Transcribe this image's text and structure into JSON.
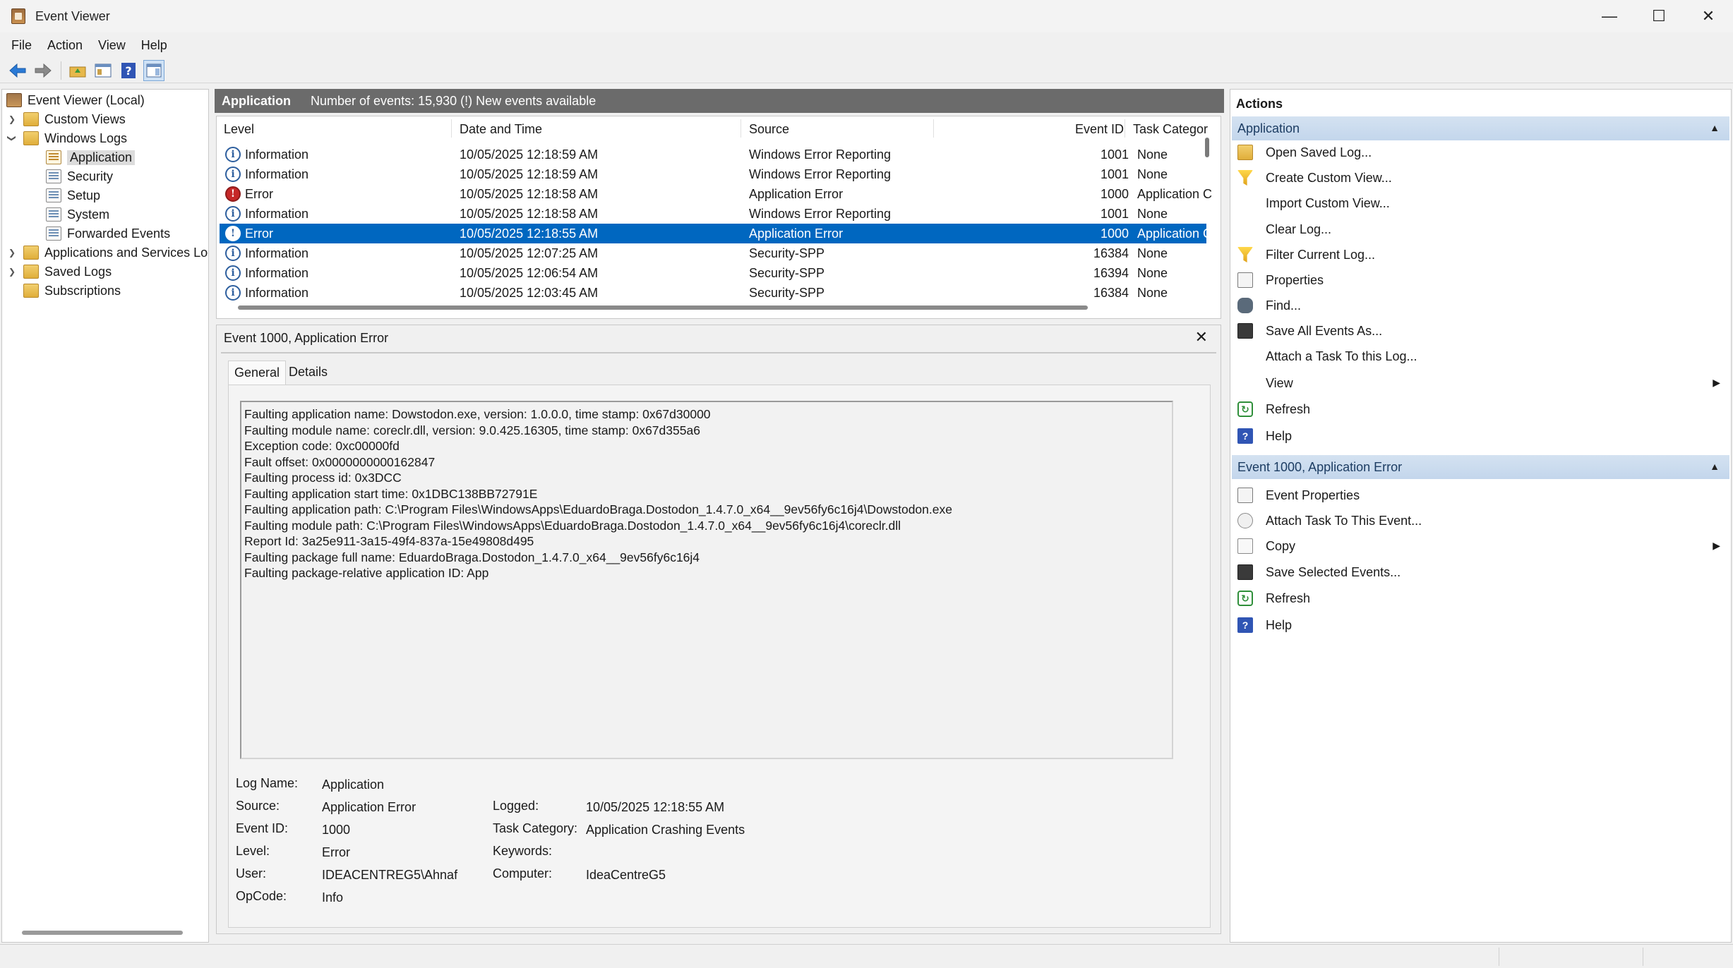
{
  "window": {
    "title": "Event Viewer",
    "minimize": "—",
    "maximize": "☐",
    "close": "✕"
  },
  "menu": [
    "File",
    "Action",
    "View",
    "Help"
  ],
  "tree": {
    "root": "Event Viewer (Local)",
    "custom_views": "Custom Views",
    "windows_logs": "Windows Logs",
    "application": "Application",
    "security": "Security",
    "setup": "Setup",
    "system": "System",
    "forwarded": "Forwarded Events",
    "apps_services": "Applications and Services Logs",
    "saved_logs": "Saved Logs",
    "subscriptions": "Subscriptions"
  },
  "header": {
    "log_name": "Application",
    "count": "Number of events: 15,930 (!) New events available"
  },
  "columns": {
    "level": "Level",
    "date": "Date and Time",
    "source": "Source",
    "event_id": "Event ID",
    "task": "Task Categor"
  },
  "events": [
    {
      "level": "Information",
      "date": "10/05/2025 12:18:59 AM",
      "source": "Windows Error Reporting",
      "id": "1001",
      "task": "None"
    },
    {
      "level": "Information",
      "date": "10/05/2025 12:18:59 AM",
      "source": "Windows Error Reporting",
      "id": "1001",
      "task": "None"
    },
    {
      "level": "Error",
      "date": "10/05/2025 12:18:58 AM",
      "source": "Application Error",
      "id": "1000",
      "task": "Application C"
    },
    {
      "level": "Information",
      "date": "10/05/2025 12:18:58 AM",
      "source": "Windows Error Reporting",
      "id": "1001",
      "task": "None"
    },
    {
      "level": "Error",
      "date": "10/05/2025 12:18:55 AM",
      "source": "Application Error",
      "id": "1000",
      "task": "Application C"
    },
    {
      "level": "Information",
      "date": "10/05/2025 12:07:25 AM",
      "source": "Security-SPP",
      "id": "16384",
      "task": "None"
    },
    {
      "level": "Information",
      "date": "10/05/2025 12:06:54 AM",
      "source": "Security-SPP",
      "id": "16394",
      "task": "None"
    },
    {
      "level": "Information",
      "date": "10/05/2025 12:03:45 AM",
      "source": "Security-SPP",
      "id": "16384",
      "task": "None"
    }
  ],
  "detail": {
    "title": "Event 1000, Application Error",
    "close": "✕",
    "tabs": {
      "general": "General",
      "details": "Details"
    },
    "description": "Faulting application name: Dowstodon.exe, version: 1.0.0.0, time stamp: 0x67d30000\nFaulting module name: coreclr.dll, version: 9.0.425.16305, time stamp: 0x67d355a6\nException code: 0xc00000fd\nFault offset: 0x0000000000162847\nFaulting process id: 0x3DCC\nFaulting application start time: 0x1DBC138BB72791E\nFaulting application path: C:\\Program Files\\WindowsApps\\EduardoBraga.Dostodon_1.4.7.0_x64__9ev56fy6c16j4\\Dowstodon.exe\nFaulting module path: C:\\Program Files\\WindowsApps\\EduardoBraga.Dostodon_1.4.7.0_x64__9ev56fy6c16j4\\coreclr.dll\nReport Id: 3a25e911-3a15-49f4-837a-15e49808d495\nFaulting package full name: EduardoBraga.Dostodon_1.4.7.0_x64__9ev56fy6c16j4\nFaulting package-relative application ID: App",
    "labels": {
      "log_name": "Log Name:",
      "source": "Source:",
      "event_id": "Event ID:",
      "level": "Level:",
      "user": "User:",
      "opcode": "OpCode:",
      "logged": "Logged:",
      "task_category": "Task Category:",
      "keywords": "Keywords:",
      "computer": "Computer:"
    },
    "values": {
      "log_name": "Application",
      "source": "Application Error",
      "event_id": "1000",
      "level": "Error",
      "user": "IDEACENTREG5\\Ahnaf",
      "opcode": "Info",
      "logged": "10/05/2025 12:18:55 AM",
      "task_category": "Application Crashing Events",
      "keywords": "",
      "computer": "IdeaCentreG5"
    }
  },
  "actions": {
    "title": "Actions",
    "section1": "Application",
    "items1": [
      "Open Saved Log...",
      "Create Custom View...",
      "Import Custom View...",
      "Clear Log...",
      "Filter Current Log...",
      "Properties",
      "Find...",
      "Save All Events As...",
      "Attach a Task To this Log...",
      "View",
      "Refresh",
      "Help"
    ],
    "section2": "Event 1000, Application Error",
    "items2": [
      "Event Properties",
      "Attach Task To This Event...",
      "Copy",
      "Save Selected Events...",
      "Refresh",
      "Help"
    ]
  },
  "colors": {
    "selection": "#0067c0",
    "header_gray": "#6b6b6b",
    "section_blue": "#c3d6ec"
  }
}
